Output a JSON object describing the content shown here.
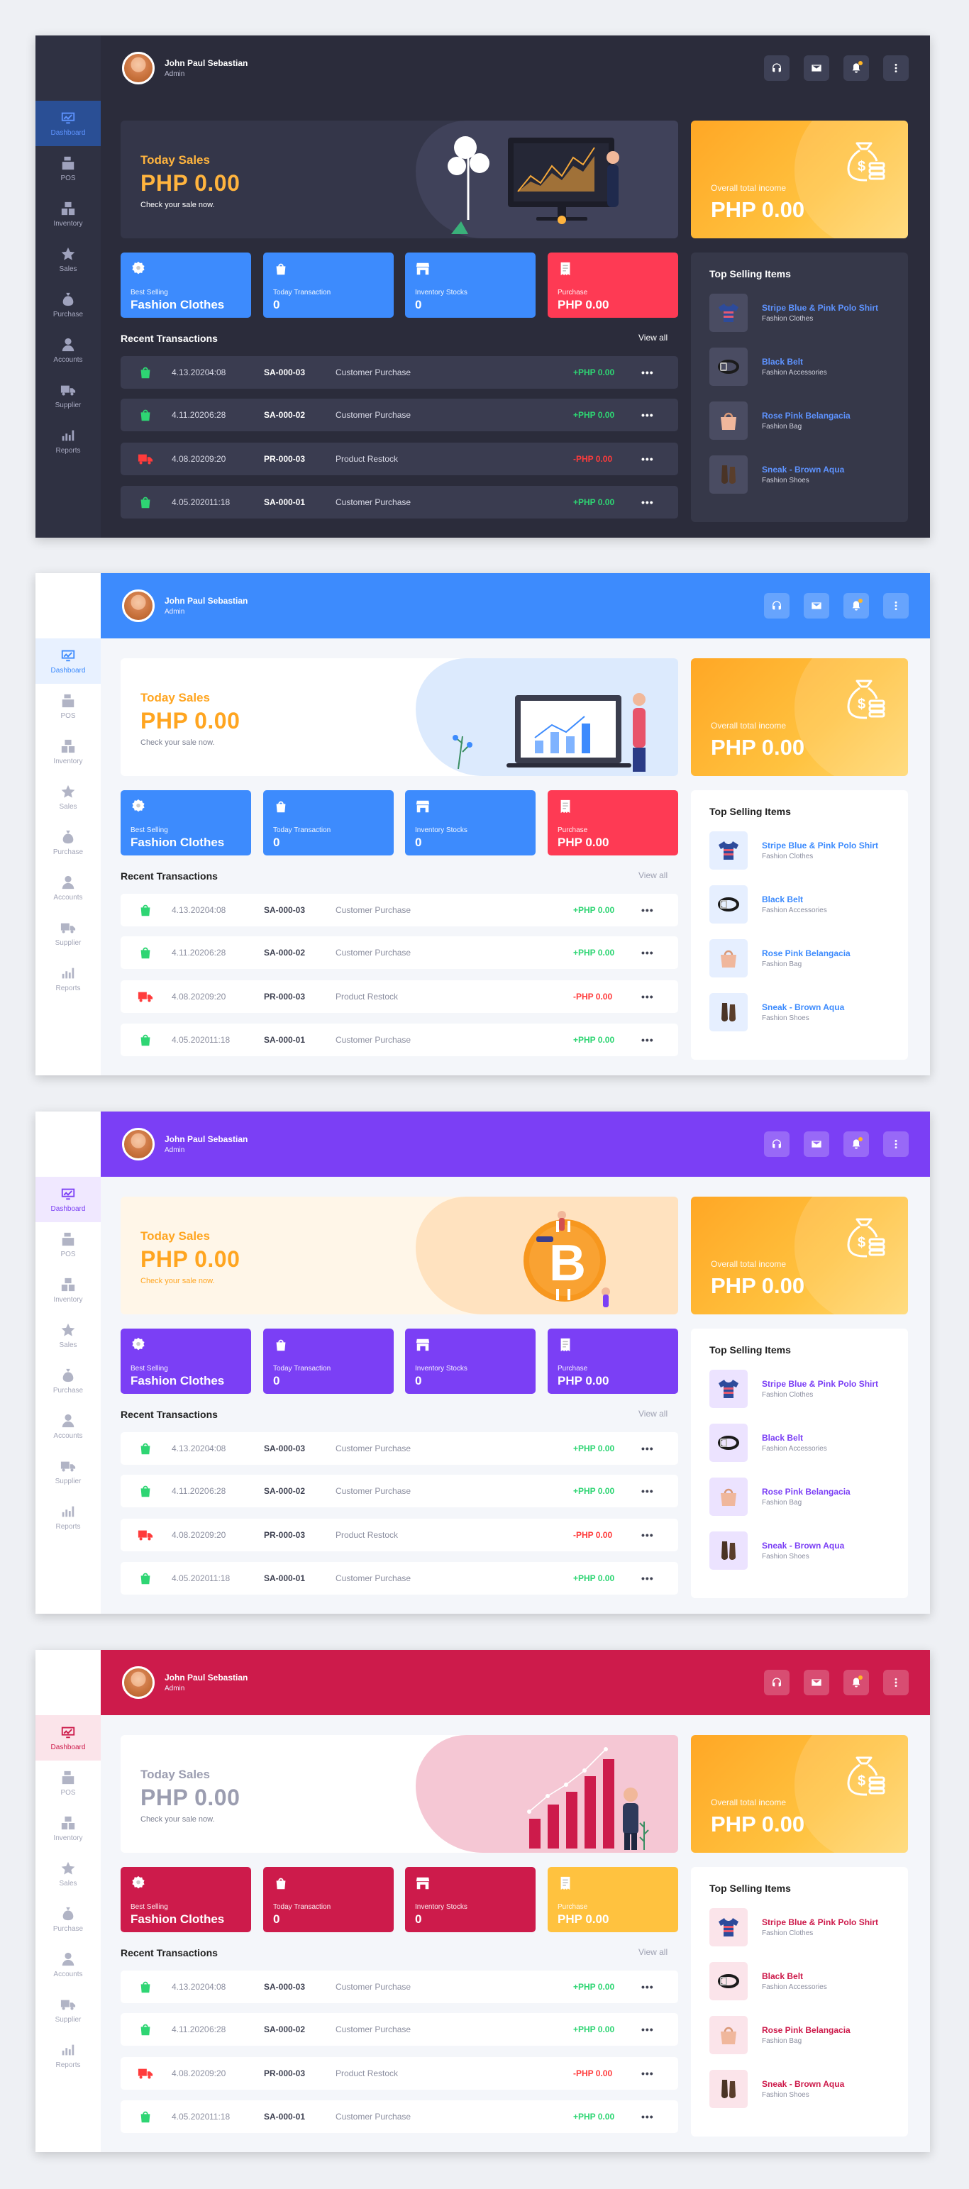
{
  "user": {
    "name": "John Paul Sebastian",
    "role": "Admin"
  },
  "nav": [
    "Dashboard",
    "POS",
    "Inventory",
    "Sales",
    "Purchase",
    "Accounts",
    "Supplier",
    "Reports"
  ],
  "hero": {
    "title": "Today Sales",
    "amount": "PHP 0.00",
    "subtitle": "Check your sale now."
  },
  "income": {
    "label": "Overall total income",
    "amount": "PHP 0.00"
  },
  "stats": [
    {
      "label": "Best Selling",
      "value": "Fashion Clothes"
    },
    {
      "label": "Today Transaction",
      "value": "0"
    },
    {
      "label": "Inventory Stocks",
      "value": "0"
    },
    {
      "label": "Purchase",
      "value": "PHP 0.00"
    }
  ],
  "recent": {
    "title": "Recent Transactions",
    "view_all": "View all"
  },
  "transactions": [
    {
      "date": "4.13.2020",
      "time": "4:08",
      "code": "SA-000-03",
      "type": "Customer Purchase",
      "amount": "+PHP 0.00",
      "more": "•••"
    },
    {
      "date": "4.11.2020",
      "time": "6:28",
      "code": "SA-000-02",
      "type": "Customer Purchase",
      "amount": "+PHP 0.00",
      "more": "•••"
    },
    {
      "date": "4.08.2020",
      "time": "9:20",
      "code": "PR-000-03",
      "type": "Product Restock",
      "amount": "-PHP 0.00",
      "more": "•••"
    },
    {
      "date": "4.05.2020",
      "time": "11:18",
      "code": "SA-000-01",
      "type": "Customer Purchase",
      "amount": "+PHP 0.00",
      "more": "•••"
    }
  ],
  "top_selling": {
    "title": "Top Selling Items",
    "items": [
      {
        "name": "Stripe Blue & Pink Polo Shirt",
        "category": "Fashion Clothes"
      },
      {
        "name": "Black Belt",
        "category": "Fashion Accessories"
      },
      {
        "name": "Rose Pink Belangacia",
        "category": "Fashion Bag"
      },
      {
        "name": "Sneak - Brown Aqua",
        "category": "Fashion Shoes"
      }
    ]
  },
  "colors": {
    "dark_bg": "#2b2c3b",
    "blue": "#3d8bfd",
    "purple": "#7b3ff5",
    "crimson": "#cd1b4b",
    "orange": "#ffa520",
    "red": "#fe3a54",
    "positive": "#2ed573",
    "negative": "#ff3b3b"
  }
}
